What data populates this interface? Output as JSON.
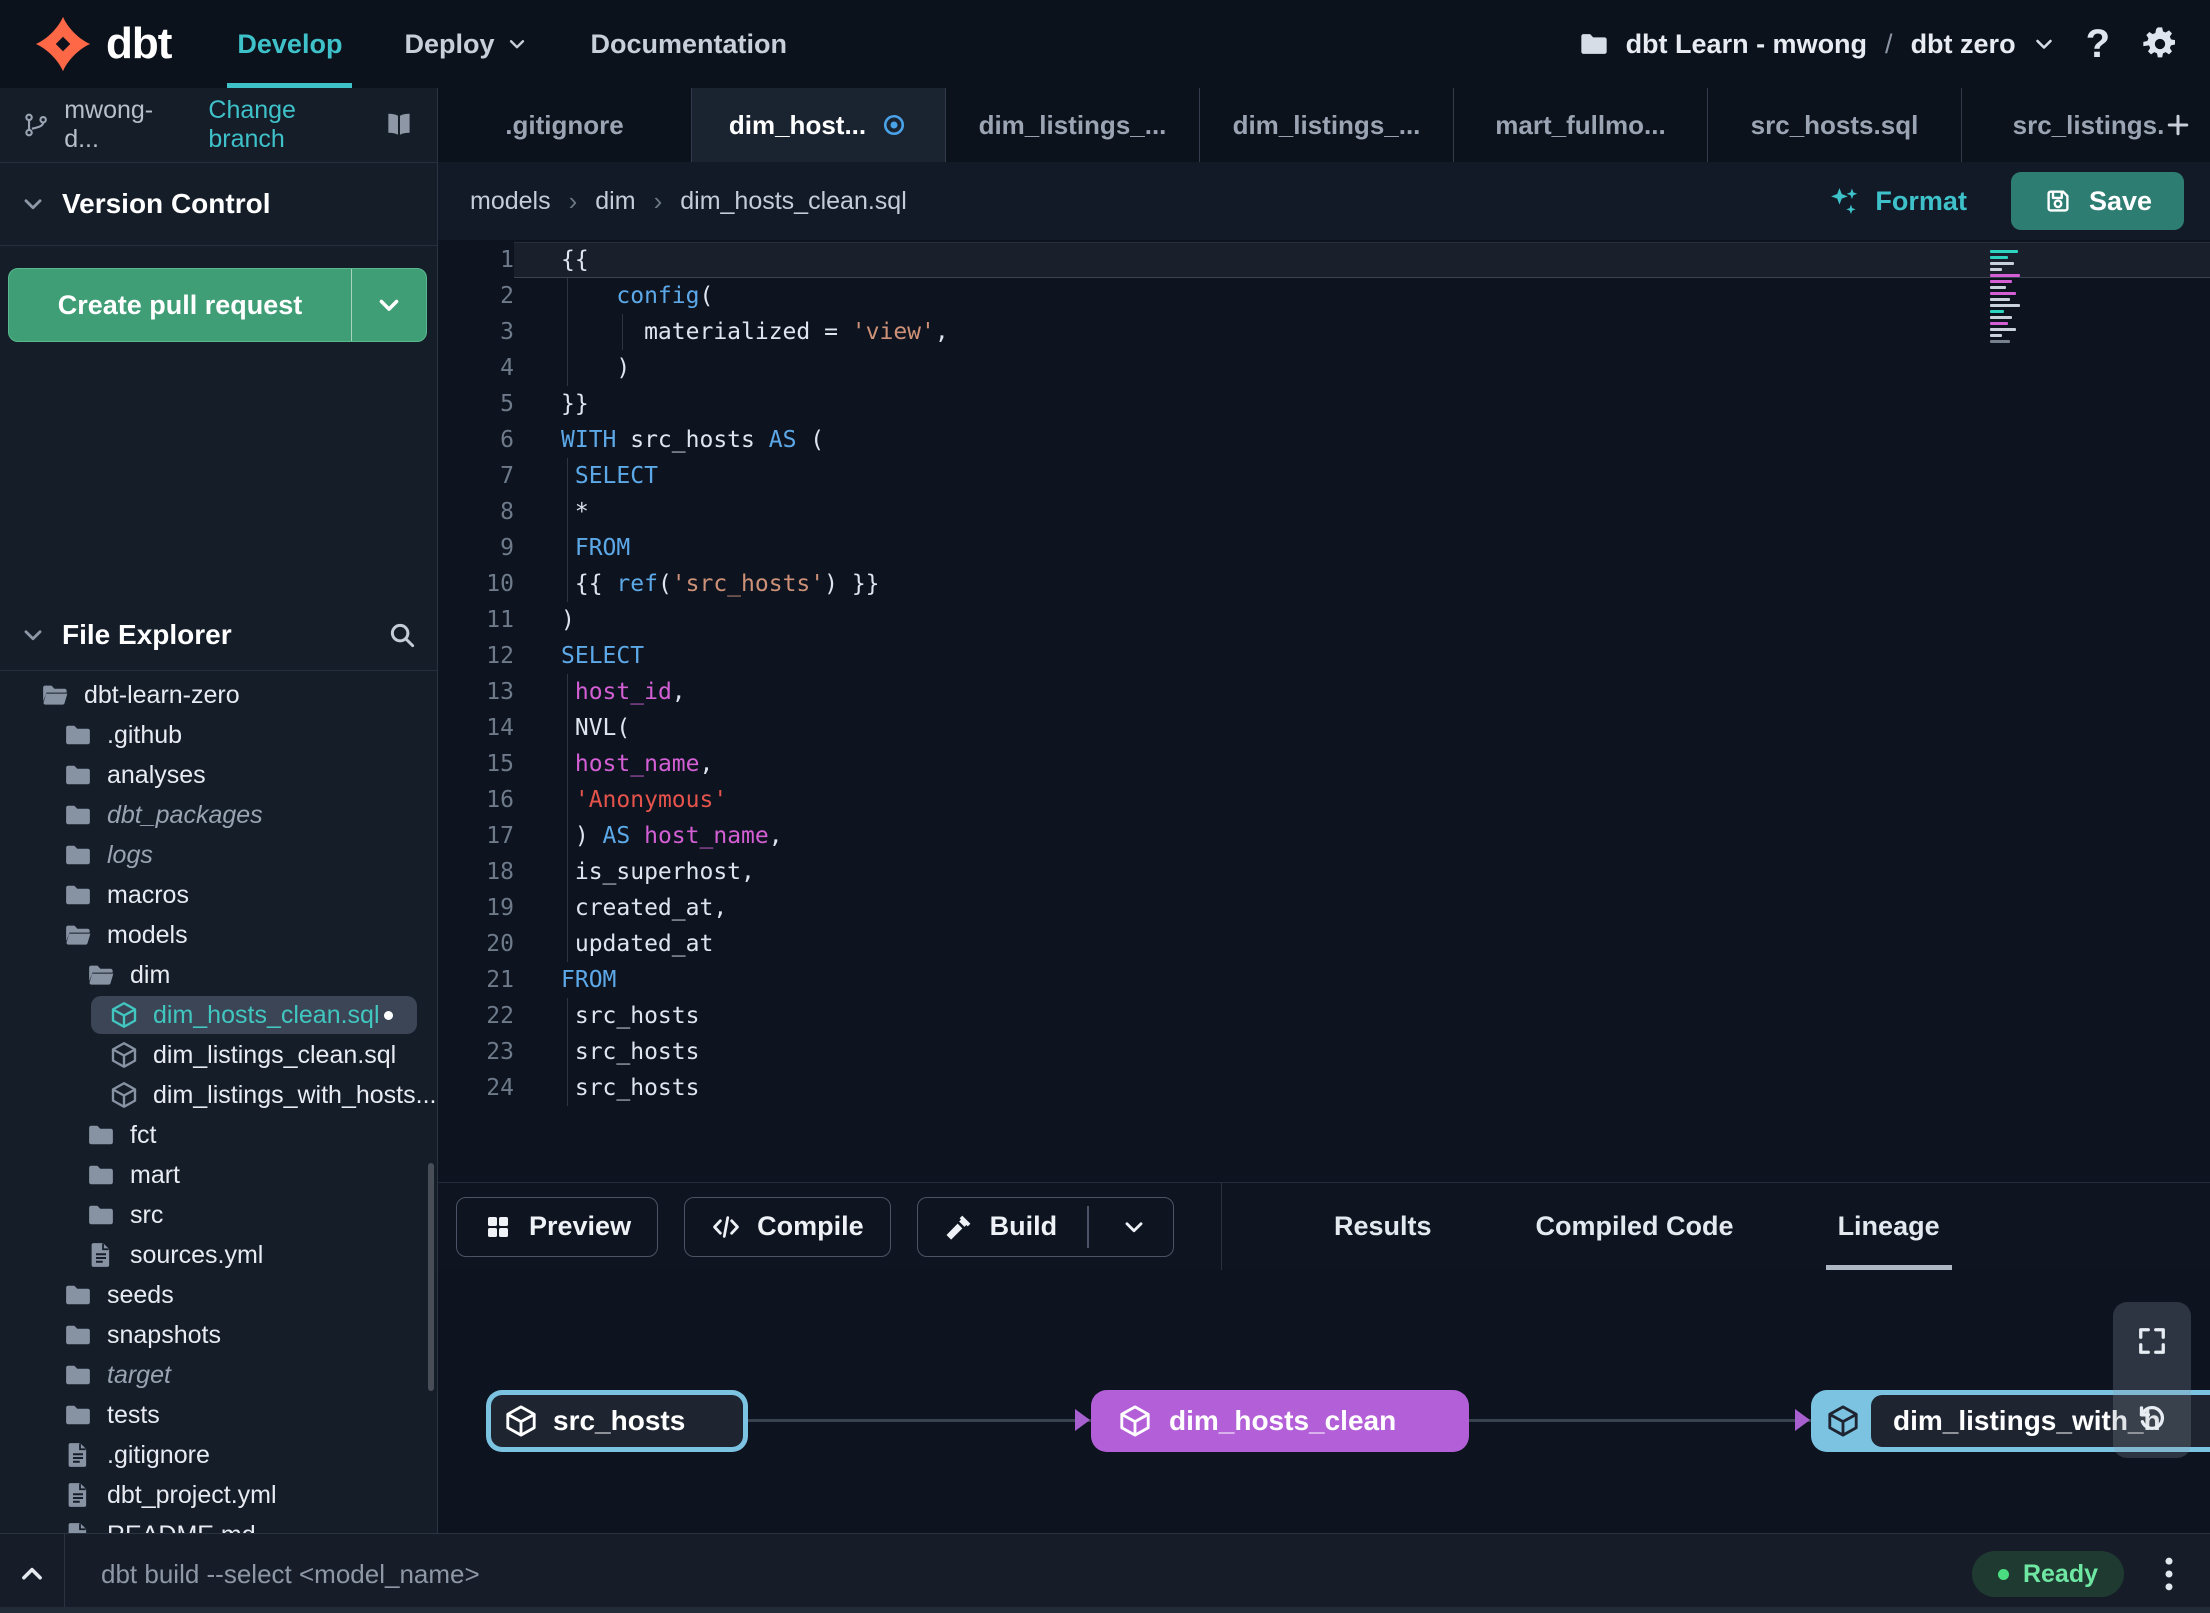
{
  "topbar": {
    "brand": "dbt",
    "nav": [
      {
        "label": "Develop",
        "active": true
      },
      {
        "label": "Deploy",
        "caret": true
      },
      {
        "label": "Documentation"
      }
    ],
    "project": {
      "name": "dbt Learn - mwong",
      "separator": "/",
      "env": "dbt zero"
    },
    "help_label": "?"
  },
  "branch_bar": {
    "branch": "mwong-d...",
    "change_label": "Change branch"
  },
  "editor_tabs": [
    {
      "label": ".gitignore"
    },
    {
      "label": "dim_host...",
      "active": true,
      "dirty": true
    },
    {
      "label": "dim_listings_..."
    },
    {
      "label": "dim_listings_..."
    },
    {
      "label": "mart_fullmo..."
    },
    {
      "label": "src_hosts.sql"
    },
    {
      "label": "src_listings."
    }
  ],
  "version_control": {
    "title": "Version Control",
    "create_pr_label": "Create pull request"
  },
  "file_explorer": {
    "title": "File Explorer",
    "tree": [
      {
        "name": "dbt-learn-zero",
        "icon": "folder-open",
        "depth": 0
      },
      {
        "name": ".github",
        "icon": "folder",
        "depth": 1
      },
      {
        "name": "analyses",
        "icon": "folder",
        "depth": 1
      },
      {
        "name": "dbt_packages",
        "icon": "folder",
        "depth": 1,
        "italic": true
      },
      {
        "name": "logs",
        "icon": "folder",
        "depth": 1,
        "italic": true
      },
      {
        "name": "macros",
        "icon": "folder",
        "depth": 1
      },
      {
        "name": "models",
        "icon": "folder-open",
        "depth": 1
      },
      {
        "name": "dim",
        "icon": "folder-open",
        "depth": 2
      },
      {
        "name": "dim_hosts_clean.sql",
        "icon": "model",
        "depth": 3,
        "selected": true,
        "dirty": true
      },
      {
        "name": "dim_listings_clean.sql",
        "icon": "model",
        "depth": 3
      },
      {
        "name": "dim_listings_with_hosts...",
        "icon": "model",
        "depth": 3
      },
      {
        "name": "fct",
        "icon": "folder",
        "depth": 2
      },
      {
        "name": "mart",
        "icon": "folder",
        "depth": 2
      },
      {
        "name": "src",
        "icon": "folder",
        "depth": 2
      },
      {
        "name": "sources.yml",
        "icon": "file",
        "depth": 2
      },
      {
        "name": "seeds",
        "icon": "folder",
        "depth": 1
      },
      {
        "name": "snapshots",
        "icon": "folder",
        "depth": 1
      },
      {
        "name": "target",
        "icon": "folder",
        "depth": 1,
        "italic": true
      },
      {
        "name": "tests",
        "icon": "folder",
        "depth": 1
      },
      {
        "name": ".gitignore",
        "icon": "file",
        "depth": 1
      },
      {
        "name": "dbt_project.yml",
        "icon": "file",
        "depth": 1
      },
      {
        "name": "README.md",
        "icon": "file",
        "depth": 1
      }
    ]
  },
  "breadcrumb": [
    "models",
    "dim",
    "dim_hosts_clean.sql"
  ],
  "toolbar": {
    "format_label": "Format",
    "save_label": "Save"
  },
  "code": {
    "lines": [
      {
        "n": 1,
        "current": true,
        "tokens": [
          [
            "{{",
            "p"
          ]
        ]
      },
      {
        "n": 2,
        "g": 1,
        "tokens": [
          [
            "    ",
            "p"
          ],
          [
            "config",
            "k"
          ],
          [
            "(",
            "p"
          ]
        ]
      },
      {
        "n": 3,
        "g": 1,
        "g2": true,
        "tokens": [
          [
            "      materialized = ",
            "p"
          ],
          [
            "'view'",
            "s"
          ],
          [
            ",",
            "p"
          ]
        ]
      },
      {
        "n": 4,
        "g": 1,
        "tokens": [
          [
            "    )",
            "p"
          ]
        ]
      },
      {
        "n": 5,
        "tokens": [
          [
            "}}",
            "p"
          ]
        ]
      },
      {
        "n": 6,
        "tokens": [
          [
            "WITH",
            "k"
          ],
          [
            " src_hosts ",
            "p"
          ],
          [
            "AS",
            "k"
          ],
          [
            " (",
            "p"
          ]
        ]
      },
      {
        "n": 7,
        "g": 1,
        "tokens": [
          [
            " ",
            "p"
          ],
          [
            "SELECT",
            "k"
          ]
        ]
      },
      {
        "n": 8,
        "g": 1,
        "tokens": [
          [
            " *",
            "p"
          ]
        ]
      },
      {
        "n": 9,
        "g": 1,
        "tokens": [
          [
            " ",
            "p"
          ],
          [
            "FROM",
            "k"
          ]
        ]
      },
      {
        "n": 10,
        "g": 1,
        "tokens": [
          [
            " {{ ",
            "p"
          ],
          [
            "ref",
            "k"
          ],
          [
            "(",
            "p"
          ],
          [
            "'src_hosts'",
            "s"
          ],
          [
            ") }}",
            "p"
          ]
        ]
      },
      {
        "n": 11,
        "tokens": [
          [
            ")",
            "p"
          ]
        ]
      },
      {
        "n": 12,
        "tokens": [
          [
            "SELECT",
            "k"
          ]
        ]
      },
      {
        "n": 13,
        "g": 1,
        "tokens": [
          [
            " ",
            "p"
          ],
          [
            "host_id",
            "m"
          ],
          [
            ",",
            "p"
          ]
        ]
      },
      {
        "n": 14,
        "g": 1,
        "tokens": [
          [
            " NVL(",
            "p"
          ]
        ]
      },
      {
        "n": 15,
        "g": 1,
        "tokens": [
          [
            " ",
            "p"
          ],
          [
            "host_name",
            "m"
          ],
          [
            ",",
            "p"
          ]
        ]
      },
      {
        "n": 16,
        "g": 1,
        "tokens": [
          [
            " ",
            "p"
          ],
          [
            "'Anonymous'",
            "r"
          ]
        ]
      },
      {
        "n": 17,
        "g": 1,
        "tokens": [
          [
            " ) ",
            "p"
          ],
          [
            "AS",
            "k"
          ],
          [
            " ",
            "p"
          ],
          [
            "host_name",
            "m"
          ],
          [
            ",",
            "p"
          ]
        ]
      },
      {
        "n": 18,
        "g": 1,
        "tokens": [
          [
            " is_superhost,",
            "p"
          ]
        ]
      },
      {
        "n": 19,
        "g": 1,
        "tokens": [
          [
            " created_at,",
            "p"
          ]
        ]
      },
      {
        "n": 20,
        "g": 1,
        "tokens": [
          [
            " updated_at",
            "p"
          ]
        ]
      },
      {
        "n": 21,
        "tokens": [
          [
            "FROM",
            "k"
          ]
        ]
      },
      {
        "n": 22,
        "g": 1,
        "tokens": [
          [
            " src_hosts",
            "p"
          ]
        ]
      },
      {
        "n": 23,
        "g": 1,
        "tokens": [
          [
            " src_hosts",
            "p"
          ]
        ]
      },
      {
        "n": 24,
        "g": 1,
        "tokens": [
          [
            " src_hosts",
            "p"
          ]
        ]
      }
    ]
  },
  "minimap": [
    [
      28,
      "t"
    ],
    [
      18,
      "t"
    ],
    [
      24,
      "w"
    ],
    [
      12,
      "w"
    ],
    [
      30,
      "m"
    ],
    [
      22,
      "m"
    ],
    [
      16,
      "w"
    ],
    [
      26,
      "m"
    ],
    [
      20,
      "w"
    ],
    [
      30,
      "w"
    ],
    [
      14,
      "t"
    ],
    [
      22,
      "w"
    ],
    [
      18,
      "m"
    ],
    [
      26,
      "w"
    ],
    [
      12,
      "w"
    ],
    [
      20,
      "g"
    ]
  ],
  "bottom_panel": {
    "actions": [
      {
        "label": "Preview",
        "icon": "grid"
      },
      {
        "label": "Compile",
        "icon": "code"
      },
      {
        "label": "Build",
        "icon": "hammer",
        "split": true
      }
    ],
    "tabs": [
      {
        "label": "Results"
      },
      {
        "label": "Compiled Code"
      },
      {
        "label": "Lineage",
        "active": true
      }
    ]
  },
  "lineage": {
    "nodes": [
      {
        "label": "src_hosts",
        "variant": "source"
      },
      {
        "label": "dim_hosts_clean",
        "variant": "model"
      },
      {
        "label": "dim_listings_with_h",
        "variant": "source2"
      }
    ]
  },
  "statusbar": {
    "command": "dbt build --select <model_name>",
    "status": "Ready"
  },
  "colors": {
    "accent_teal": "#3ec1c9",
    "pr_green": "#3f9e75",
    "save_green": "#2e7d72",
    "node_purple": "#b35fd8",
    "node_blue": "#7cc3e2",
    "ready_green": "#6ee7a3",
    "dirty_blue": "#4aa3e8",
    "logo_orange": "#ff6847"
  }
}
